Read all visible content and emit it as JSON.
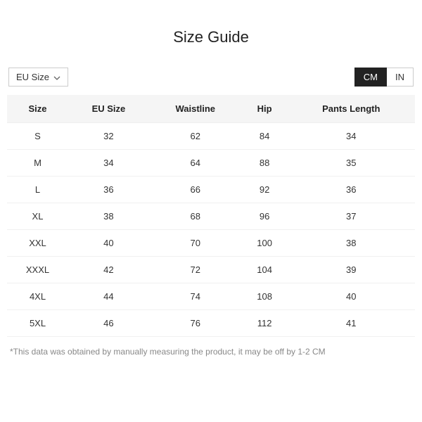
{
  "title": "Size Guide",
  "region_dropdown": {
    "label": "EU Size"
  },
  "unit_toggle": {
    "cm": "CM",
    "in": "IN",
    "active": "cm"
  },
  "table": {
    "headers": [
      "Size",
      "EU Size",
      "Waistline",
      "Hip",
      "Pants Length"
    ],
    "rows": [
      [
        "S",
        "32",
        "62",
        "84",
        "34"
      ],
      [
        "M",
        "34",
        "64",
        "88",
        "35"
      ],
      [
        "L",
        "36",
        "66",
        "92",
        "36"
      ],
      [
        "XL",
        "38",
        "68",
        "96",
        "37"
      ],
      [
        "XXL",
        "40",
        "70",
        "100",
        "38"
      ],
      [
        "XXXL",
        "42",
        "72",
        "104",
        "39"
      ],
      [
        "4XL",
        "44",
        "74",
        "108",
        "40"
      ],
      [
        "5XL",
        "46",
        "76",
        "112",
        "41"
      ]
    ]
  },
  "footnote": "*This data was obtained by manually measuring the product, it may be off by 1-2 CM"
}
